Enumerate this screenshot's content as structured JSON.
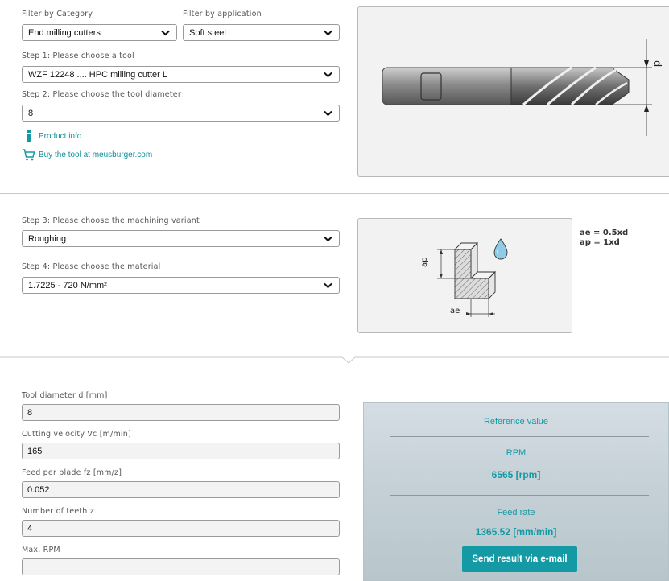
{
  "filters": {
    "category_label": "Filter by Category",
    "category_value": "End milling cutters",
    "application_label": "Filter by application",
    "application_value": "Soft steel"
  },
  "step1": {
    "label": "Step 1: Please choose a tool",
    "value": "WZF 12248 .... HPC milling cutter L"
  },
  "step2": {
    "label": "Step 2: Please choose the tool diameter",
    "value": "8"
  },
  "links": {
    "product_info": "Product info",
    "buy": "Buy the tool at meusburger.com"
  },
  "tool_image": {
    "dimension_label": "d"
  },
  "step3": {
    "label": "Step 3: Please choose the machining variant",
    "value": "Roughing"
  },
  "step4": {
    "label": "Step 4: Please choose the material",
    "value": "1.7225 - 720 N/mm²"
  },
  "machining_diagram": {
    "ap_label": "ap",
    "ae_label": "ae",
    "ae_formula": "ae = 0.5xd",
    "ap_formula": "ap = 1xd"
  },
  "fields": [
    {
      "label": "Tool diameter d [mm]",
      "value": "8"
    },
    {
      "label": "Cutting velocity Vc [m/min]",
      "value": "165"
    },
    {
      "label": "Feed per blade fz [mm/z]",
      "value": "0.052"
    },
    {
      "label": "Number of teeth z",
      "value": "4"
    },
    {
      "label": "Max. RPM",
      "value": ""
    }
  ],
  "result": {
    "reference_label": "Reference value",
    "rpm_label": "RPM",
    "rpm_value": "6565 [rpm]",
    "feed_label": "Feed rate",
    "feed_value": "1365.52 [mm/min]",
    "email_button": "Send result via e-mail"
  },
  "colors": {
    "accent": "#139aa5",
    "border": "#9a9a9a",
    "result_bg": "#c4d0d6"
  }
}
